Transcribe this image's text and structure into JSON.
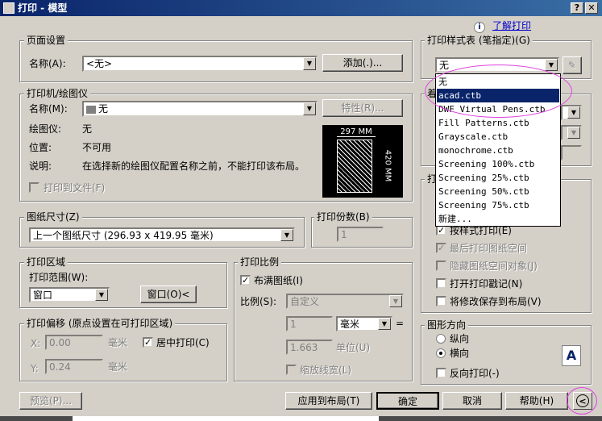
{
  "window": {
    "title": "打印 - 模型",
    "help_btn": "?",
    "close_btn": "✕"
  },
  "help_link": {
    "icon": "i",
    "label": "了解打印"
  },
  "page_setup": {
    "title": "页面设置",
    "name_label": "名称(A):",
    "name_value": "<无>",
    "add_button": "添加(.)..."
  },
  "printer": {
    "title": "打印机/绘图仪",
    "name_label": "名称(M):",
    "name_value": "无",
    "properties_button": "特性(R)...",
    "plotter_label": "绘图仪:",
    "plotter_value": "无",
    "location_label": "位置:",
    "location_value": "不可用",
    "description_label": "说明:",
    "description_value": "在选择新的绘图仪配置名称之前，不能打印该布局。",
    "print_to_file": "打印到文件(F)",
    "preview_width": "297 MM",
    "preview_height": "420 MM"
  },
  "paper_size": {
    "title": "图纸尺寸(Z)",
    "value": "上一个图纸尺寸 (296.93 x 419.95 毫米)"
  },
  "copies": {
    "title": "打印份数(B)",
    "value": "1"
  },
  "plot_area": {
    "title": "打印区域",
    "range_label": "打印范围(W):",
    "range_value": "窗口",
    "window_button": "窗口(O)<"
  },
  "plot_scale": {
    "title": "打印比例",
    "fit_to_paper": "布满图纸(I)",
    "scale_label": "比例(S):",
    "scale_value": "自定义",
    "value1": "1",
    "unit1": "毫米",
    "equals": "=",
    "value2": "1.663",
    "unit2_label": "单位(U)",
    "scale_lineweights": "缩放线宽(L)"
  },
  "plot_offset": {
    "title": "打印偏移 (原点设置在可打印区域)",
    "x_label": "X:",
    "x_value": "0.00",
    "x_unit": "毫米",
    "y_label": "Y:",
    "y_value": "0.24",
    "y_unit": "毫米",
    "center_plot": "居中打印(C)"
  },
  "plot_style_table": {
    "title": "打印样式表 (笔指定)(G)",
    "selected": "无",
    "options": [
      "无",
      "acad.ctb",
      "DWF Virtual Pens.ctb",
      "Fill Patterns.ctb",
      "Grayscale.ctb",
      "monochrome.ctb",
      "Screening 100%.ctb",
      "Screening 25%.ctb",
      "Screening 50%.ctb",
      "Screening 75%.ctb",
      "新建..."
    ],
    "highlighted": "acad.ctb"
  },
  "shaded_viewport": {
    "partial_label": "着"
  },
  "plot_options": {
    "partial_label": "打",
    "items": [
      {
        "label": "按样式打印(E)",
        "checked": true,
        "enabled": true
      },
      {
        "label": "最后打印图纸空间",
        "checked": true,
        "enabled": false
      },
      {
        "label": "隐藏图纸空间对象(J)",
        "checked": false,
        "enabled": false
      },
      {
        "label": "打开打印戳记(N)",
        "checked": false,
        "enabled": true
      },
      {
        "label": "将修改保存到布局(V)",
        "checked": false,
        "enabled": true
      }
    ]
  },
  "orientation": {
    "title": "图形方向",
    "portrait": "纵向",
    "landscape": "横向",
    "selected": "横向",
    "upside_down": "反向打印(-)",
    "icon_letter": "A"
  },
  "footer": {
    "preview": "预览(P)...",
    "apply": "应用到布局(T)",
    "ok": "确定",
    "cancel": "取消",
    "help": "帮助(H)",
    "expand": "<"
  },
  "colors": {
    "titlebar": "#0a246a",
    "face": "#d4d0c8",
    "selection": "#0a246a",
    "annotation": "#e040e0"
  }
}
